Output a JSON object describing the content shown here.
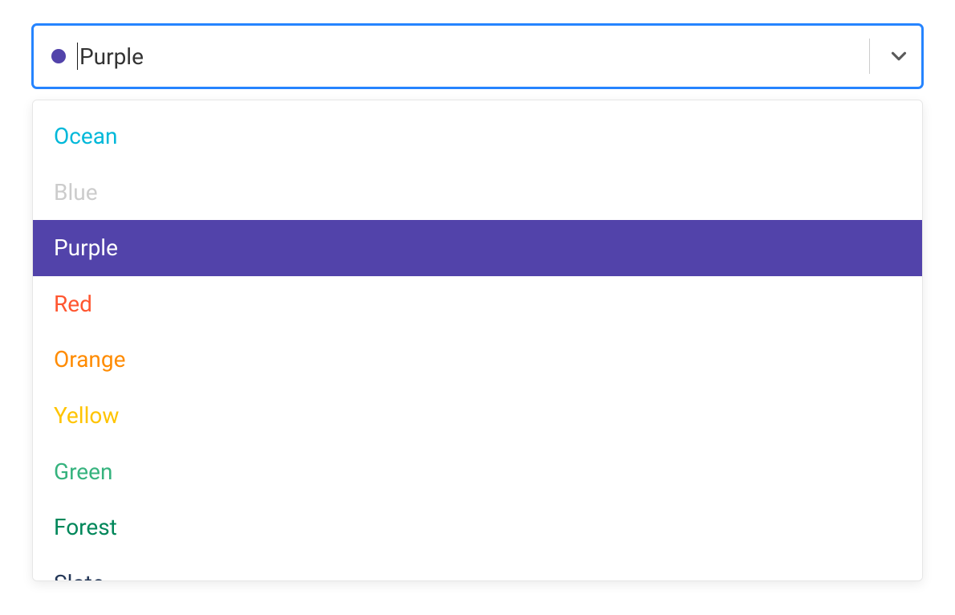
{
  "select": {
    "selected_label": "Purple",
    "selected_color": "#5243AA",
    "options": [
      {
        "label": "Ocean",
        "color": "#00B8D9",
        "disabled": false,
        "selected": false
      },
      {
        "label": "Blue",
        "color": "#0052CC",
        "disabled": true,
        "selected": false
      },
      {
        "label": "Purple",
        "color": "#5243AA",
        "disabled": false,
        "selected": true
      },
      {
        "label": "Red",
        "color": "#FF5630",
        "disabled": false,
        "selected": false
      },
      {
        "label": "Orange",
        "color": "#FF8B00",
        "disabled": false,
        "selected": false
      },
      {
        "label": "Yellow",
        "color": "#FFC400",
        "disabled": false,
        "selected": false
      },
      {
        "label": "Green",
        "color": "#36B37E",
        "disabled": false,
        "selected": false
      },
      {
        "label": "Forest",
        "color": "#00875A",
        "disabled": false,
        "selected": false
      },
      {
        "label": "Slate",
        "color": "#253858",
        "disabled": false,
        "selected": false
      }
    ]
  }
}
